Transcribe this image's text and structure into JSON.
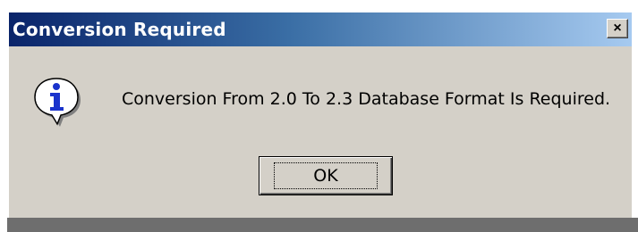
{
  "dialog": {
    "title": "Conversion Required",
    "close_label": "×",
    "icon": "info-icon",
    "message": "Conversion From 2.0 To 2.3 Database Format Is Required.",
    "ok_label": "OK"
  },
  "colors": {
    "titlebar_start": "#0a246a",
    "titlebar_end": "#a6caf0",
    "dialog_face": "#d4d0c8"
  }
}
